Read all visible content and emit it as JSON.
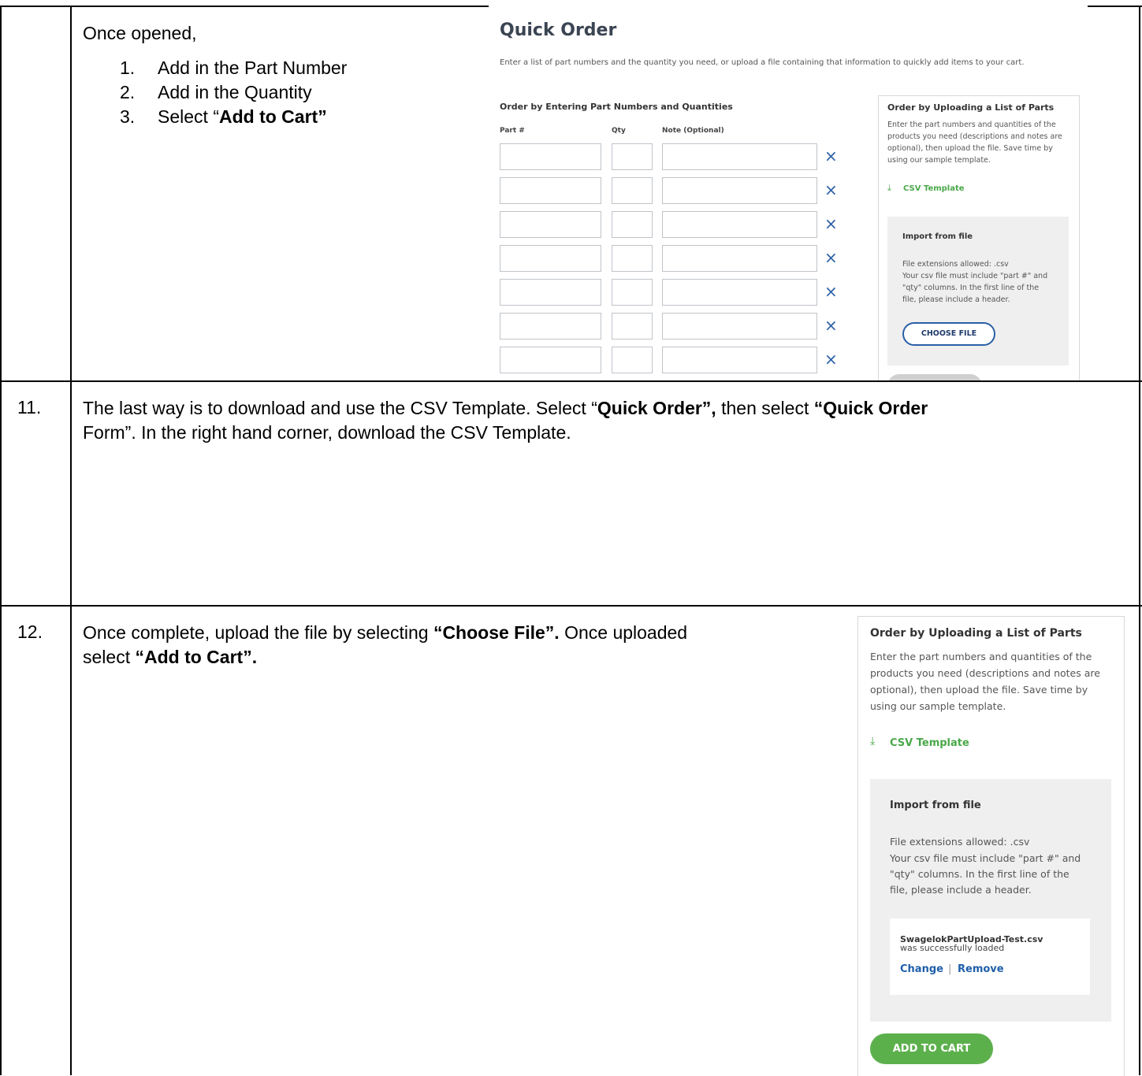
{
  "row1": {
    "intro": "Once opened,",
    "steps": [
      {
        "num": "1.",
        "text": "Add in the Part Number"
      },
      {
        "num": "2.",
        "text": "Add in the Quantity"
      },
      {
        "num": "3.",
        "pre": "Select “",
        "bold": "Add to Cart”"
      }
    ]
  },
  "quick_order": {
    "title": "Quick Order",
    "subtitle": "Enter a list of part numbers and the quantity you need, or upload a file containing that information to quickly add items to your cart.",
    "entry_heading": "Order by Entering Part Numbers and Quantities",
    "col_part": "Part #",
    "col_qty": "Qty",
    "col_note": "Note (Optional)",
    "remove_glyph": "×",
    "row_count": 7
  },
  "upload_panel": {
    "title": "Order by Uploading a List of Parts",
    "desc_lines": [
      "Enter the part numbers and quantities of the",
      "products you need (descriptions and notes are",
      "optional), then upload the file. Save time by",
      "using our sample template."
    ],
    "csv_link": "CSV Template",
    "download_icon": "download-icon",
    "import_title": "Import from file",
    "import_lines": [
      "File extensions allowed: .csv",
      "Your csv file must include \"part #\" and",
      "\"qty\" columns. In the first line of the",
      "file, please include a header."
    ],
    "choose_button": "CHOOSE FILE"
  },
  "row11": {
    "num": "11.",
    "p1": "The last way is to download and use the CSV Template. Select “",
    "b1": "Quick Order”,",
    "p2": " then select ",
    "b2": "“Quick Order",
    "p3": "Form”. In the right hand corner, download the CSV Template."
  },
  "row12": {
    "num": "12.",
    "p1": "Once complete, upload the file by selecting ",
    "b1": "“Choose File”.",
    "p2": " Once uploaded",
    "p3": "select ",
    "b2": "“Add to Cart”."
  },
  "upload_result": {
    "file_name": "SwagelokPartUpload-Test.csv",
    "message": "was successfully loaded",
    "change": "Change",
    "separator": "|",
    "remove": "Remove",
    "add_to_cart": "ADD TO CART"
  },
  "colors": {
    "title": "#3a4452",
    "link_green": "#4aa84a",
    "remove_blue": "#2a5fa6",
    "button_green": "#5cb04c"
  }
}
